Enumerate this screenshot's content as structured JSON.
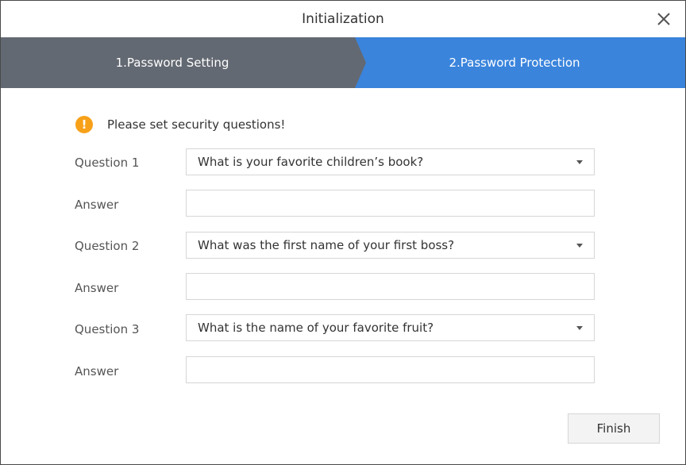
{
  "window": {
    "title": "Initialization"
  },
  "steps": [
    {
      "label": "1.Password Setting"
    },
    {
      "label": "2.Password Protection"
    }
  ],
  "notice": {
    "icon": "warning-icon",
    "text": "Please set security questions!"
  },
  "questions": [
    {
      "label": "Question 1",
      "selected": "What is your favorite children’s book?",
      "answer_label": "Answer",
      "answer_value": ""
    },
    {
      "label": "Question 2",
      "selected": "What was the first name of your first boss?",
      "answer_label": "Answer",
      "answer_value": ""
    },
    {
      "label": "Question 3",
      "selected": "What is the name of your favorite fruit?",
      "answer_label": "Answer",
      "answer_value": ""
    }
  ],
  "actions": {
    "finish_label": "Finish"
  },
  "colors": {
    "step_inactive": "#636972",
    "step_active": "#3a84dc",
    "warning": "#f7a11a"
  }
}
